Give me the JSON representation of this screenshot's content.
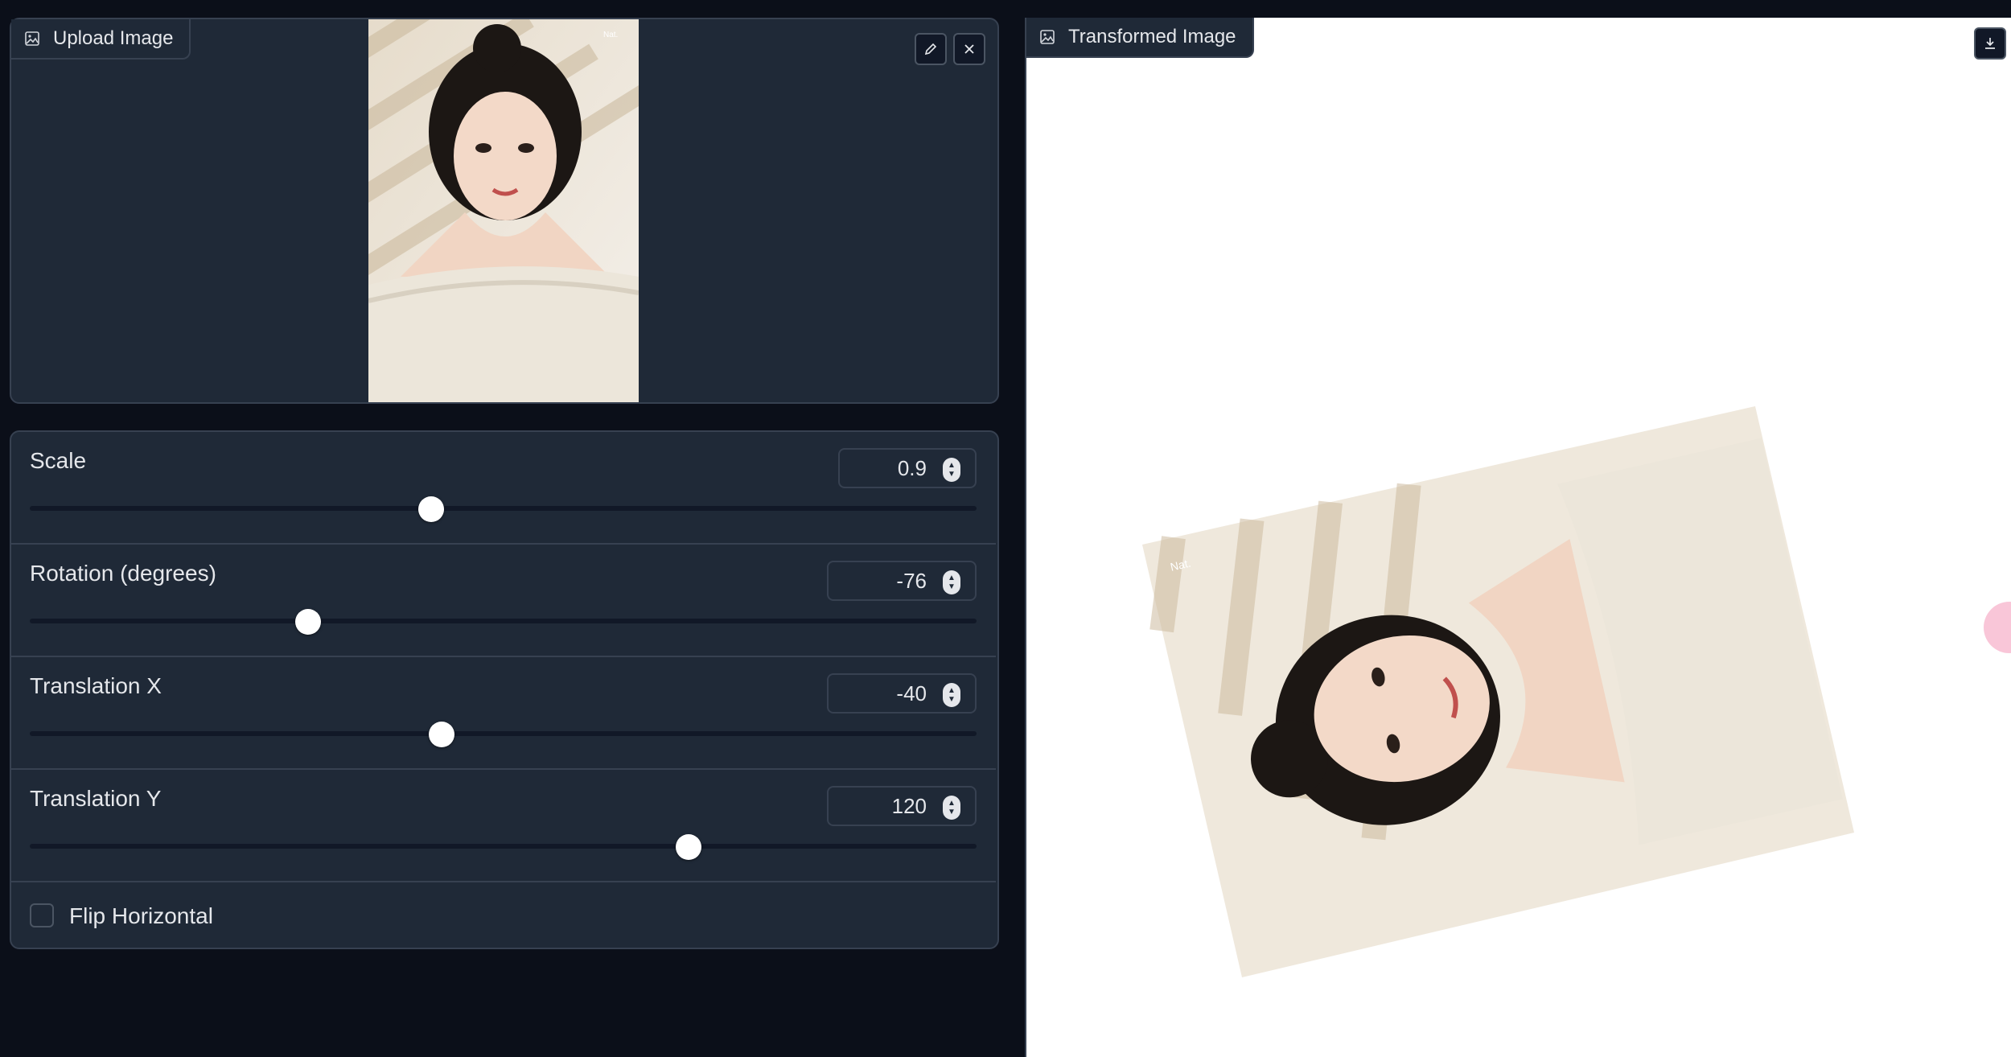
{
  "upload_panel": {
    "label": "Upload Image",
    "watermark": "Nat."
  },
  "output_panel": {
    "label": "Transformed Image",
    "watermark": "Nat."
  },
  "controls": {
    "scale": {
      "label": "Scale",
      "value": "0.9",
      "fraction": 0.424
    },
    "rotation": {
      "label": "Rotation (degrees)",
      "value": "-76",
      "fraction": 0.294
    },
    "translation_x": {
      "label": "Translation X",
      "value": "-40",
      "fraction": 0.435
    },
    "translation_y": {
      "label": "Translation Y",
      "value": "120",
      "fraction": 0.696
    },
    "flip_horizontal": {
      "label": "Flip Horizontal",
      "checked": false
    }
  },
  "icons": {
    "image": "image-icon",
    "edit": "pencil-icon",
    "clear": "close-icon",
    "download": "download-icon"
  },
  "colors": {
    "background": "#0b0f19",
    "panel": "#1f2937",
    "border": "#374151",
    "output_bg": "#ffffff",
    "fab_accent": "#f9c6d8"
  }
}
